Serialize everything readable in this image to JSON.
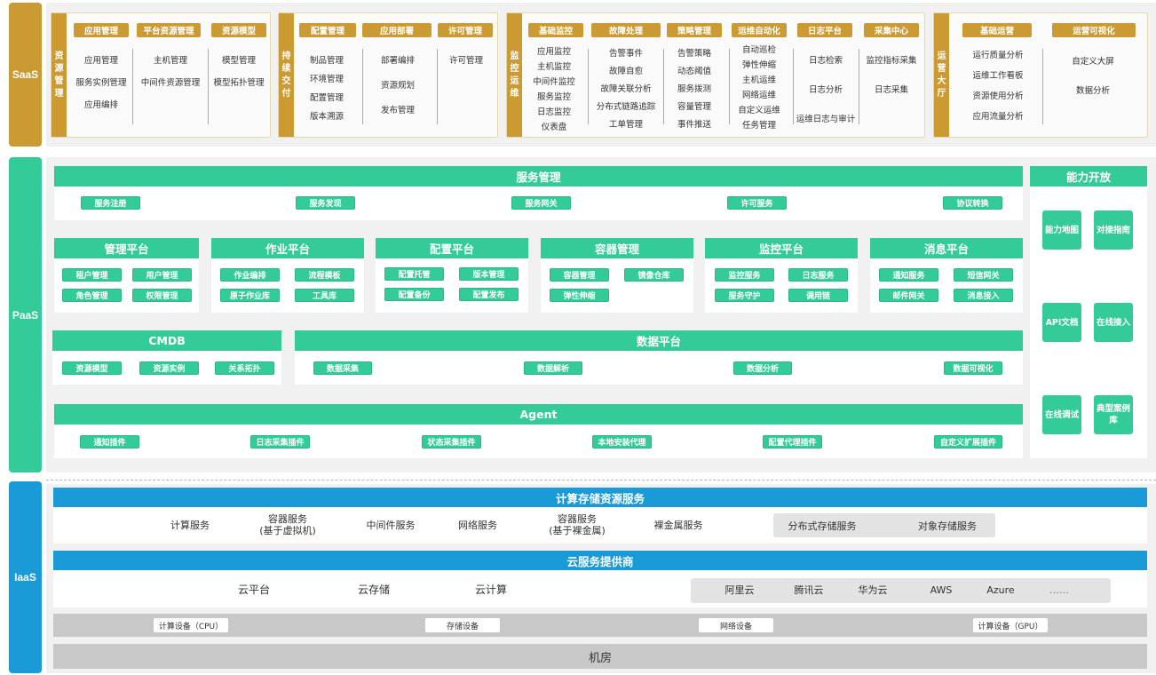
{
  "layers": {
    "saas": "SaaS",
    "paas": "PaaS",
    "iaas": "IaaS"
  },
  "colors": {
    "saas": "#cc9a33",
    "paas": "#33cc99",
    "iaas": "#1a9bd7",
    "device_bar": "#c8c8c8"
  },
  "saas": {
    "groups": [
      {
        "title": "资源管理",
        "columns": [
          {
            "header": "应用管理",
            "items": [
              "应用管理",
              "服务实例管理",
              "应用编排"
            ]
          },
          {
            "header": "平台资源管理",
            "items": [
              "主机管理",
              "中间件资源管理"
            ]
          },
          {
            "header": "资源模型",
            "items": [
              "模型管理",
              "模型拓扑管理"
            ]
          }
        ]
      },
      {
        "title": "持续交付",
        "columns": [
          {
            "header": "配置管理",
            "items": [
              "制品管理",
              "环境管理",
              "配置管理",
              "版本溯源"
            ]
          },
          {
            "header": "应用部署",
            "items": [
              "部署编排",
              "资源规划",
              "发布管理"
            ]
          },
          {
            "header": "许可管理",
            "items": [
              "许可管理"
            ]
          }
        ]
      },
      {
        "title": "监控运维",
        "columns": [
          {
            "header": "基础监控",
            "items": [
              "应用监控",
              "主机监控",
              "中间件监控",
              "服务监控",
              "日志监控",
              "仪表盘"
            ]
          },
          {
            "header": "故障处理",
            "items": [
              "告警事件",
              "故障自愈",
              "故障关联分析",
              "分布式链路追踪",
              "工单管理"
            ]
          },
          {
            "header": "策略管理",
            "items": [
              "告警策略",
              "动态阈值",
              "服务拨测",
              "容量管理",
              "事件推送"
            ]
          },
          {
            "header": "运维自动化",
            "items": [
              "自动巡检",
              "弹性伸缩",
              "主机运维",
              "网络运维",
              "自定义运维",
              "任务管理"
            ]
          },
          {
            "header": "日志平台",
            "items": [
              "日志检索",
              "日志分析",
              "运维日志与审计"
            ]
          },
          {
            "header": "采集中心",
            "items": [
              "监控指标采集",
              "日志采集"
            ]
          }
        ]
      },
      {
        "title": "运营大厅",
        "columns": [
          {
            "header": "基础运营",
            "items": [
              "运行质量分析",
              "运维工作看板",
              "资源使用分析",
              "应用流量分析"
            ]
          },
          {
            "header": "运营可视化",
            "items": [
              "自定义大屏",
              "数据分析"
            ]
          }
        ]
      }
    ]
  },
  "paas": {
    "service_mgmt": {
      "title": "服务管理",
      "items": [
        "服务注册",
        "服务发现",
        "服务网关",
        "许可服务",
        "协议转换"
      ]
    },
    "platforms": [
      {
        "title": "管理平台",
        "items": [
          "租户管理",
          "用户管理",
          "角色管理",
          "权限管理"
        ]
      },
      {
        "title": "作业平台",
        "items": [
          "作业编排",
          "流程模板",
          "原子作业库",
          "工具库"
        ]
      },
      {
        "title": "配置平台",
        "items": [
          "配置托管",
          "版本管理",
          "配置备份",
          "配置发布"
        ]
      },
      {
        "title": "容器管理",
        "items": [
          "容器管理",
          "镜像仓库",
          "弹性伸缩"
        ]
      },
      {
        "title": "监控平台",
        "items": [
          "监控服务",
          "日志服务",
          "服务守护",
          "调用链"
        ]
      },
      {
        "title": "消息平台",
        "items": [
          "通知服务",
          "短信网关",
          "邮件网关",
          "消息接入"
        ]
      }
    ],
    "cmdb": {
      "title": "CMDB",
      "items": [
        "资源模型",
        "资源实例",
        "关系拓扑"
      ]
    },
    "data_platform": {
      "title": "数据平台",
      "items": [
        "数据采集",
        "数据解析",
        "数据分析",
        "数据可视化"
      ]
    },
    "agent": {
      "title": "Agent",
      "items": [
        "通知插件",
        "日志采集插件",
        "状态采集插件",
        "本地安装代理",
        "配置代理插件",
        "自定义扩展插件"
      ]
    },
    "open": {
      "title": "能力开放",
      "items": [
        "能力地图",
        "对接指南",
        "API文档",
        "在线接入",
        "在线调试",
        "典型案例库"
      ]
    }
  },
  "iaas": {
    "compute_storage": {
      "title": "计算存储资源服务",
      "items": [
        {
          "line1": "计算服务",
          "line2": ""
        },
        {
          "line1": "容器服务",
          "line2": "(基于虚拟机)"
        },
        {
          "line1": "中间件服务",
          "line2": ""
        },
        {
          "line1": "网络服务",
          "line2": ""
        },
        {
          "line1": "容器服务",
          "line2": "(基于裸金属)"
        },
        {
          "line1": "裸金属服务",
          "line2": ""
        }
      ],
      "storage_group": [
        "分布式存储服务",
        "对象存储服务"
      ]
    },
    "cloud_provider": {
      "title": "云服务提供商",
      "items": [
        "云平台",
        "云存储",
        "云计算"
      ],
      "vendors": [
        "阿里云",
        "腾讯云",
        "华为云",
        "AWS",
        "Azure",
        "……"
      ]
    },
    "devices": [
      "计算设备（CPU）",
      "存储设备",
      "网络设备",
      "计算设备（GPU）"
    ],
    "datacenter": "机房"
  }
}
